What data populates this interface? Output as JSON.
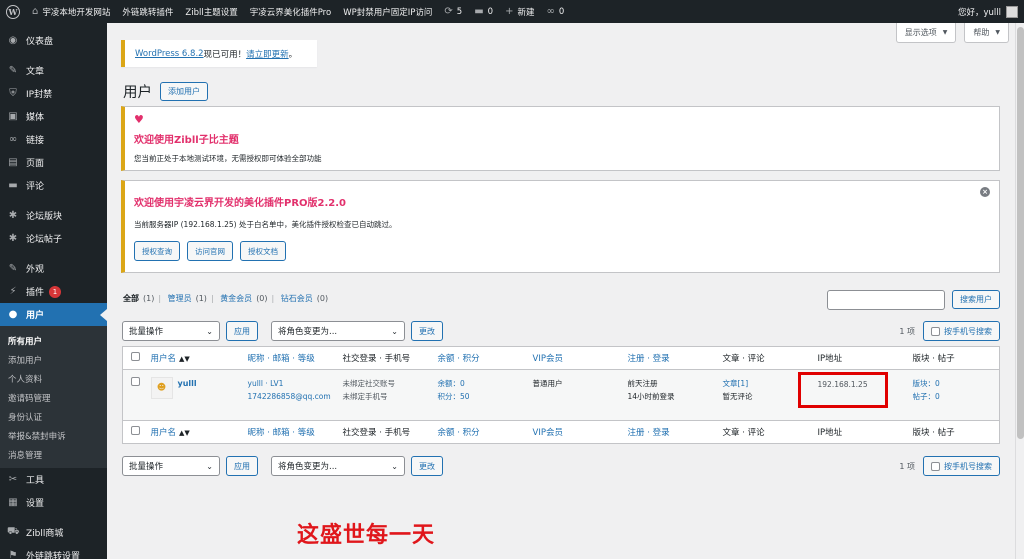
{
  "adminbar": {
    "site_name": "宇凌本地开发网站",
    "items": [
      "外链跳转插件",
      "Zibll主题设置",
      "宇凌云界美化插件Pro",
      "WP封禁用户固定IP访问"
    ],
    "updates_count": "5",
    "comments_count": "0",
    "new_label": "新建",
    "links_count": "0",
    "greeting": "您好，yulll"
  },
  "sidebar": {
    "items": [
      {
        "label": "仪表盘",
        "icon": "dashboard-icon",
        "glyph": "◉"
      },
      {
        "label": "文章",
        "icon": "pin-icon",
        "glyph": "✎"
      },
      {
        "label": "IP封禁",
        "icon": "shield-icon",
        "glyph": "⛨"
      },
      {
        "label": "媒体",
        "icon": "media-icon",
        "glyph": "▣"
      },
      {
        "label": "链接",
        "icon": "link-icon",
        "glyph": "∞"
      },
      {
        "label": "页面",
        "icon": "page-icon",
        "glyph": "▤"
      },
      {
        "label": "评论",
        "icon": "comment-icon",
        "glyph": "▬"
      },
      {
        "label": "论坛版块",
        "icon": "forum-icon",
        "glyph": "✱"
      },
      {
        "label": "论坛帖子",
        "icon": "forum-post-icon",
        "glyph": "✱"
      },
      {
        "label": "外观",
        "icon": "appearance-icon",
        "glyph": "✎"
      },
      {
        "label": "插件",
        "icon": "plugin-icon",
        "glyph": "⚡",
        "badge": "1"
      },
      {
        "label": "用户",
        "icon": "users-icon",
        "glyph": "●"
      }
    ],
    "submenu": [
      "所有用户",
      "添加用户",
      "个人资料",
      "邀请码管理",
      "身份认证",
      "举报&禁封申诉",
      "消息管理"
    ],
    "after": [
      {
        "label": "工具",
        "icon": "tools-icon",
        "glyph": "✂"
      },
      {
        "label": "设置",
        "icon": "settings-icon",
        "glyph": "▦"
      },
      {
        "label": "Zibll商城",
        "icon": "cart-icon",
        "glyph": "⛟"
      },
      {
        "label": "外链跳转设置",
        "icon": "redirect-icon",
        "glyph": "⚑"
      }
    ]
  },
  "screen_meta": {
    "screen_options": "显示选项",
    "help": "帮助"
  },
  "update_nag": {
    "version_link": "WordPress 6.8.2",
    "middle": " 现已可用！",
    "update_link": "请立即更新",
    "end": "。"
  },
  "page": {
    "title": "用户",
    "add_new": "添加用户"
  },
  "notice1": {
    "title": "欢迎使用Zibll子比主题",
    "desc": "您当前正处于本地测试环境，无需授权即可体验全部功能"
  },
  "notice2": {
    "title": "欢迎使用宇凌云界开发的美化插件PRO版2.2.0",
    "desc": "当前服务器IP (192.168.1.25) 处于白名单中，美化插件授权检查已自动跳过。",
    "buttons": [
      "授权查询",
      "访问官网",
      "授权文档"
    ]
  },
  "filters": [
    {
      "label": "全部",
      "count": "(1)"
    },
    {
      "label": "管理员",
      "count": "(1)"
    },
    {
      "label": "黄金会员",
      "count": "(0)"
    },
    {
      "label": "钻石会员",
      "count": "(0)"
    }
  ],
  "search_button": "搜索用户",
  "tablenav": {
    "bulk": "批量操作",
    "apply": "应用",
    "role": "将角色变更为...",
    "change": "更改",
    "count": "1 项",
    "phone_search": "按手机号搜索"
  },
  "columns": [
    "用户名",
    "昵称 · 邮箱 · 等级",
    "社交登录 · 手机号",
    "余额 · 积分",
    "VIP会员",
    "注册 · 登录",
    "文章 · 评论",
    "IP地址",
    "版块 · 帖子"
  ],
  "users": [
    {
      "username": "yulll",
      "nick": "yulll · LV1",
      "email": "1742286858@qq.com",
      "social": "未绑定社交账号",
      "phone": "未绑定手机号",
      "balance": "余额：0",
      "points": "积分：50",
      "vip": "普通用户",
      "registered": "前天注册",
      "login": "14小时前登录",
      "posts": "文章[1]",
      "comments": "暂无评论",
      "ip": "192.168.1.25",
      "forums": "版块：0",
      "threads": "帖子：0"
    }
  ],
  "overlay_text": "这盛世每一天",
  "colors": {
    "accent": "#2271b1",
    "warning_border": "#dba617",
    "highlight": "#e00000",
    "pink": "#e2306c"
  }
}
